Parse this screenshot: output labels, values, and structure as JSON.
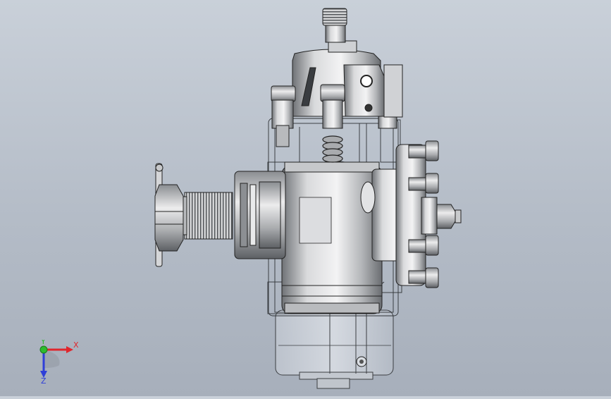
{
  "viewport": {
    "model": "steering-gear-assembly"
  },
  "triad": {
    "x_label": "X",
    "y_label": "Y",
    "z_label": "Z",
    "x_color": "#e0262c",
    "y_color": "#2dbb2d",
    "z_color": "#2f3fd8"
  }
}
